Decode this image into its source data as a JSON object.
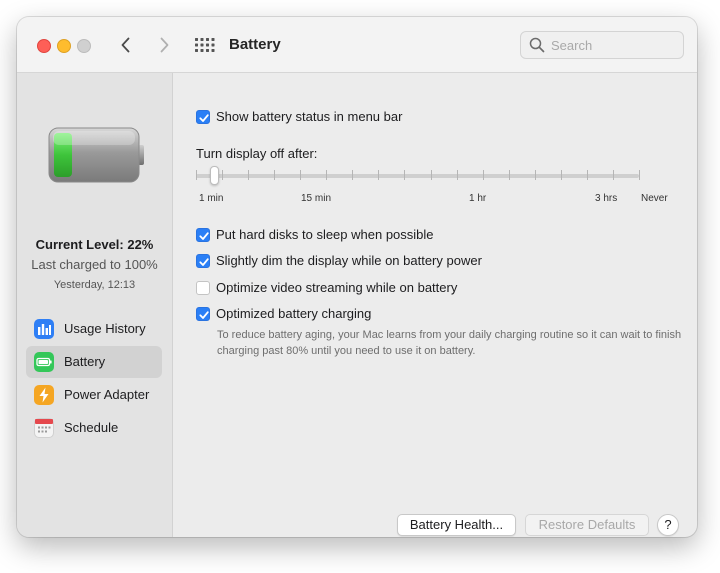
{
  "window": {
    "title": "Battery"
  },
  "search": {
    "placeholder": "Search"
  },
  "sidebar": {
    "current_level": "Current Level: 22%",
    "last_charged": "Last charged to 100%",
    "charged_time": "Yesterday, 12:13",
    "battery_level": 0.22,
    "items": [
      {
        "label": "Usage History",
        "icon": "chart-bars-icon",
        "color": "#2f7ff5"
      },
      {
        "label": "Battery",
        "icon": "battery-icon",
        "color": "#34c759"
      },
      {
        "label": "Power Adapter",
        "icon": "lightning-bolt-icon",
        "color": "#f5a623"
      },
      {
        "label": "Schedule",
        "icon": "calendar-icon",
        "color": "#e5484d"
      }
    ],
    "selected": "Battery"
  },
  "settings": {
    "show_status": {
      "label": "Show battery status in menu bar",
      "checked": true
    },
    "display_off": {
      "label": "Turn display off after:",
      "ticks": [
        "1 min",
        "15 min",
        "1 hr",
        "3 hrs",
        "Never"
      ],
      "value": "1 min"
    },
    "hard_disks": {
      "label": "Put hard disks to sleep when possible",
      "checked": true
    },
    "dim_display": {
      "label": "Slightly dim the display while on battery power",
      "checked": true
    },
    "video_streaming": {
      "label": "Optimize video streaming while on battery",
      "checked": false
    },
    "optimized_charging": {
      "label": "Optimized battery charging",
      "checked": true,
      "note": "To reduce battery aging, your Mac learns from your daily charging routine so it can wait to finish charging past 80% until you need to use it on battery."
    }
  },
  "buttons": {
    "battery_health": "Battery Health...",
    "restore_defaults": "Restore Defaults",
    "help": "?"
  },
  "colors": {
    "accent": "#2a7ff6",
    "battery_green": "#3ec43b"
  }
}
